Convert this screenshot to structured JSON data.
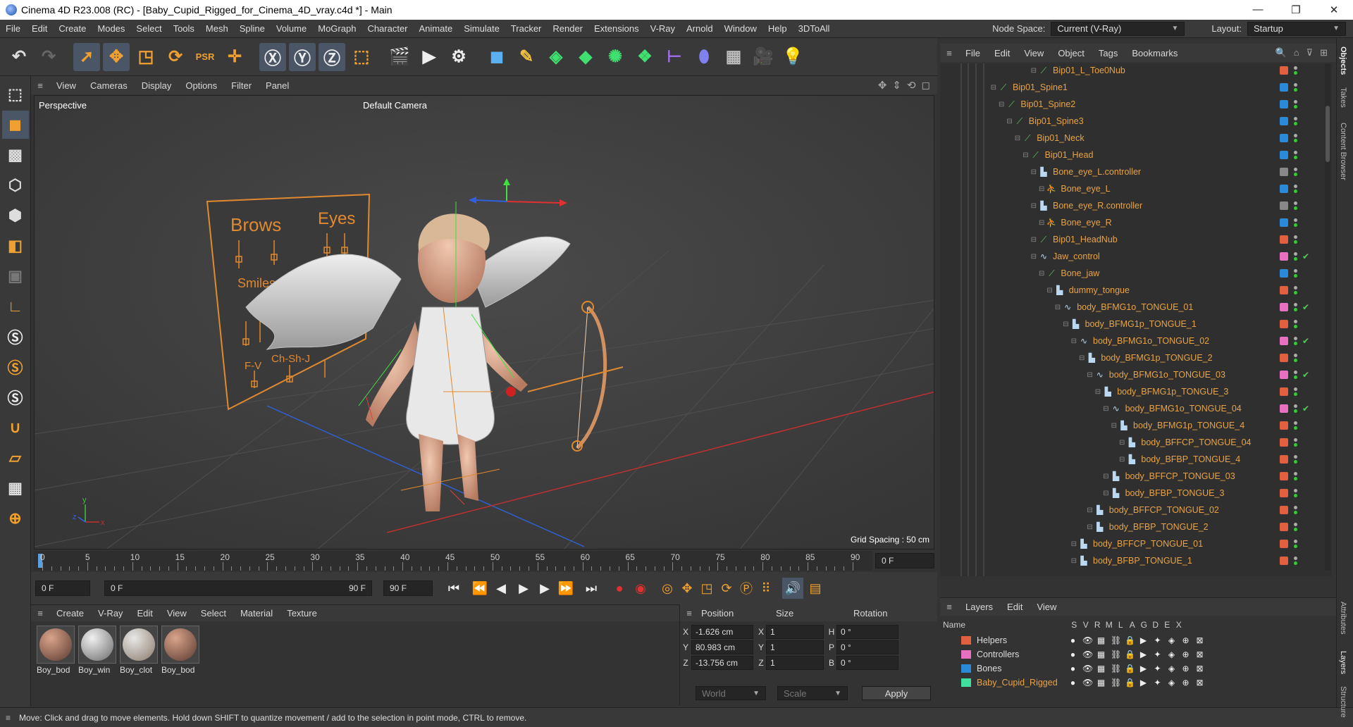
{
  "window": {
    "title": "Cinema 4D R23.008 (RC) - [Baby_Cupid_Rigged_for_Cinema_4D_vray.c4d *] - Main",
    "controls": [
      "—",
      "❐",
      "✕"
    ]
  },
  "menubar": {
    "items": [
      "File",
      "Edit",
      "Create",
      "Modes",
      "Select",
      "Tools",
      "Mesh",
      "Spline",
      "Volume",
      "MoGraph",
      "Character",
      "Animate",
      "Simulate",
      "Tracker",
      "Render",
      "Extensions",
      "V-Ray",
      "Arnold",
      "Window",
      "Help",
      "3DToAll"
    ],
    "node_space_label": "Node Space:",
    "node_space_value": "Current (V-Ray)",
    "layout_label": "Layout:",
    "layout_value": "Startup"
  },
  "viewport": {
    "menu": [
      "View",
      "Cameras",
      "Display",
      "Options",
      "Filter",
      "Panel"
    ],
    "perspective": "Perspective",
    "camera": "Default Camera",
    "grid_spacing": "Grid Spacing : 50 cm",
    "board_labels": {
      "brows": "Brows",
      "eyes": "Eyes",
      "smiles": "Smiles",
      "fv": "F-V",
      "chsh": "Ch-Sh-J"
    }
  },
  "timeline": {
    "ticks": [
      "0",
      "5",
      "10",
      "15",
      "20",
      "25",
      "30",
      "35",
      "40",
      "45",
      "50",
      "55",
      "60",
      "65",
      "70",
      "75",
      "80",
      "85",
      "90"
    ],
    "current_frame": "0 F",
    "start": "0 F",
    "range_start": "0 F",
    "range_end": "90 F",
    "end": "90 F"
  },
  "materials": {
    "menu": [
      "Create",
      "V-Ray",
      "Edit",
      "View",
      "Select",
      "Material",
      "Texture"
    ],
    "items": [
      {
        "name": "Boy_bod",
        "c1": "#d9a38a",
        "c2": "#5a3a30"
      },
      {
        "name": "Boy_win",
        "c1": "#f0f0f0",
        "c2": "#6a6a6a"
      },
      {
        "name": "Boy_clot",
        "c1": "#e8e8e8",
        "c2": "#8a7a6a"
      },
      {
        "name": "Boy_bod",
        "c1": "#d9a38a",
        "c2": "#5a3a30"
      }
    ]
  },
  "coordinates": {
    "headers": [
      "Position",
      "Size",
      "Rotation"
    ],
    "rows": [
      {
        "axis": "X",
        "pos": "-1.626 cm",
        "saxis": "X",
        "size": "1",
        "raxis": "H",
        "rot": "0 °"
      },
      {
        "axis": "Y",
        "pos": "80.983 cm",
        "saxis": "Y",
        "size": "1",
        "raxis": "P",
        "rot": "0 °"
      },
      {
        "axis": "Z",
        "pos": "-13.756 cm",
        "saxis": "Z",
        "size": "1",
        "raxis": "B",
        "rot": "0 °"
      }
    ],
    "mode": "World",
    "size_mode": "Scale",
    "apply": "Apply"
  },
  "status": "Move: Click and drag to move elements. Hold down SHIFT to quantize movement / add to the selection in point mode, CTRL to remove.",
  "objects": {
    "menu": [
      "File",
      "Edit",
      "View",
      "Object",
      "Tags",
      "Bookmarks"
    ],
    "rows": [
      {
        "name": "Bip01_L_Toe0Nub",
        "indent": 10,
        "icon": "bone",
        "layer": "#e06040",
        "check": false
      },
      {
        "name": "Bip01_Spine1",
        "indent": 5,
        "icon": "bone",
        "layer": "#2a8ad8",
        "check": false
      },
      {
        "name": "Bip01_Spine2",
        "indent": 6,
        "icon": "bone",
        "layer": "#2a8ad8",
        "check": false
      },
      {
        "name": "Bip01_Spine3",
        "indent": 7,
        "icon": "bone",
        "layer": "#2a8ad8",
        "check": false
      },
      {
        "name": "Bip01_Neck",
        "indent": 8,
        "icon": "bone",
        "layer": "#2a8ad8",
        "check": false
      },
      {
        "name": "Bip01_Head",
        "indent": 9,
        "icon": "bone",
        "layer": "#2a8ad8",
        "check": false
      },
      {
        "name": "Bone_eye_L.controller",
        "indent": 10,
        "icon": "null",
        "layer": "#888",
        "check": false
      },
      {
        "name": "Bone_eye_L",
        "indent": 11,
        "icon": "joint",
        "layer": "#2a8ad8",
        "check": false
      },
      {
        "name": "Bone_eye_R.controller",
        "indent": 10,
        "icon": "null",
        "layer": "#888",
        "check": false
      },
      {
        "name": "Bone_eye_R",
        "indent": 11,
        "icon": "joint",
        "layer": "#2a8ad8",
        "check": false
      },
      {
        "name": "Bip01_HeadNub",
        "indent": 10,
        "icon": "bone",
        "layer": "#e06040",
        "check": false
      },
      {
        "name": "Jaw_control",
        "indent": 10,
        "icon": "spline",
        "layer": "#e870c0",
        "check": true
      },
      {
        "name": "Bone_jaw",
        "indent": 11,
        "icon": "bone",
        "layer": "#2a8ad8",
        "check": false
      },
      {
        "name": "dummy_tongue",
        "indent": 12,
        "icon": "null",
        "layer": "#e06040",
        "check": false
      },
      {
        "name": "body_BFMG1o_TONGUE_01",
        "indent": 13,
        "icon": "spline",
        "layer": "#e870c0",
        "check": true
      },
      {
        "name": "body_BFMG1p_TONGUE_1",
        "indent": 14,
        "icon": "null",
        "layer": "#e06040",
        "check": false
      },
      {
        "name": "body_BFMG1o_TONGUE_02",
        "indent": 15,
        "icon": "spline",
        "layer": "#e870c0",
        "check": true
      },
      {
        "name": "body_BFMG1p_TONGUE_2",
        "indent": 16,
        "icon": "null",
        "layer": "#e06040",
        "check": false
      },
      {
        "name": "body_BFMG1o_TONGUE_03",
        "indent": 17,
        "icon": "spline",
        "layer": "#e870c0",
        "check": true
      },
      {
        "name": "body_BFMG1p_TONGUE_3",
        "indent": 18,
        "icon": "null",
        "layer": "#e06040",
        "check": false
      },
      {
        "name": "body_BFMG1o_TONGUE_04",
        "indent": 19,
        "icon": "spline",
        "layer": "#e870c0",
        "check": true
      },
      {
        "name": "body_BFMG1p_TONGUE_4",
        "indent": 20,
        "icon": "null",
        "layer": "#e06040",
        "check": false
      },
      {
        "name": "body_BFFCP_TONGUE_04",
        "indent": 21,
        "icon": "null",
        "layer": "#e06040",
        "check": false
      },
      {
        "name": "body_BFBP_TONGUE_4",
        "indent": 21,
        "icon": "null",
        "layer": "#e06040",
        "check": false
      },
      {
        "name": "body_BFFCP_TONGUE_03",
        "indent": 19,
        "icon": "null",
        "layer": "#e06040",
        "check": false
      },
      {
        "name": "body_BFBP_TONGUE_3",
        "indent": 19,
        "icon": "null",
        "layer": "#e06040",
        "check": false
      },
      {
        "name": "body_BFFCP_TONGUE_02",
        "indent": 17,
        "icon": "null",
        "layer": "#e06040",
        "check": false
      },
      {
        "name": "body_BFBP_TONGUE_2",
        "indent": 17,
        "icon": "null",
        "layer": "#e06040",
        "check": false
      },
      {
        "name": "body_BFFCP_TONGUE_01",
        "indent": 15,
        "icon": "null",
        "layer": "#e06040",
        "check": false
      },
      {
        "name": "body_BFBP_TONGUE_1",
        "indent": 15,
        "icon": "null",
        "layer": "#e06040",
        "check": false
      }
    ]
  },
  "layers": {
    "menu": [
      "Layers",
      "Edit",
      "View"
    ],
    "name_col": "Name",
    "cols": [
      "S",
      "V",
      "R",
      "M",
      "L",
      "A",
      "G",
      "D",
      "E",
      "X"
    ],
    "rows": [
      {
        "name": "Helpers",
        "color": "#e06040",
        "active": false
      },
      {
        "name": "Controllers",
        "color": "#e870c0",
        "active": false
      },
      {
        "name": "Bones",
        "color": "#2a8ad8",
        "active": false
      },
      {
        "name": "Baby_Cupid_Rigged",
        "color": "#40e0a0",
        "active": true
      }
    ]
  },
  "side_tabs": [
    "Objects",
    "Takes",
    "Content Browser",
    "Attributes",
    "Layers",
    "Structure"
  ]
}
